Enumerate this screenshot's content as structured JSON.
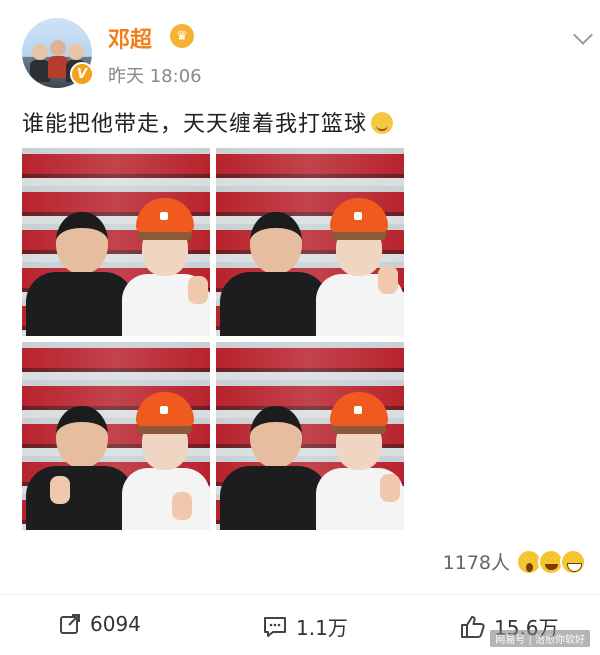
{
  "header": {
    "username": "邓超",
    "timestamp": "昨天 18:06",
    "verified_badge": "V",
    "member_icon": "crown-icon"
  },
  "post": {
    "text": "谁能把他带走，天天缠着我打篮球",
    "photos": [
      "photo-1",
      "photo-2",
      "photo-3",
      "photo-4"
    ]
  },
  "reactions": {
    "count": "1178人",
    "emojis": [
      "wow-emoji-icon",
      "laugh-emoji-icon",
      "grin-emoji-icon"
    ]
  },
  "actions": {
    "repost": "6094",
    "comment": "1.1万",
    "like": "15.6万"
  },
  "watermark": "网易号 | 治愈你软好",
  "colors": {
    "username": "#f07f1a",
    "timestamp": "#888888",
    "hat": "#f05a1e"
  }
}
